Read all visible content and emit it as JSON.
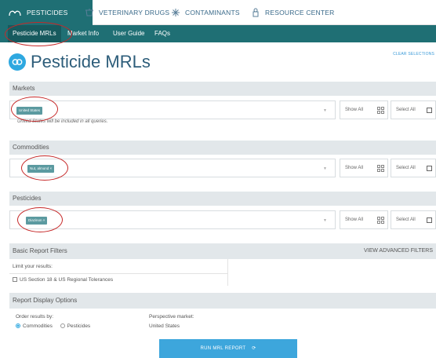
{
  "topnav": {
    "tabs": [
      {
        "label": "PESTICIDES",
        "icon": "pesticide-icon",
        "active": true
      },
      {
        "label": "VETERINARY DRUGS",
        "icon": "feeder-icon",
        "active": false
      },
      {
        "label": "CONTAMINANTS",
        "icon": "contaminant-icon",
        "active": false
      },
      {
        "label": "RESOURCE CENTER",
        "icon": "resource-icon",
        "active": false
      }
    ]
  },
  "subnav": {
    "items": [
      {
        "label": "Pesticide MRLs",
        "active": true
      },
      {
        "label": "Market Info",
        "active": false
      },
      {
        "label": "User Guide",
        "active": false
      },
      {
        "label": "FAQs",
        "active": false
      }
    ]
  },
  "page": {
    "title": "Pesticide MRLs",
    "clear_selections": "CLEAR SELECTIONS"
  },
  "markets": {
    "header": "Markets",
    "chip": "United States",
    "note": "United States will be included in all queries.",
    "show_all": "Show All",
    "select_all": "Select All"
  },
  "commodities": {
    "header": "Commodities",
    "chip": "Nut, almond ×",
    "show_all": "Show All",
    "select_all": "Select All"
  },
  "pesticides": {
    "header": "Pesticides",
    "chip": "Diazinon ×",
    "show_all": "Show All",
    "select_all": "Select All"
  },
  "basic_filters": {
    "header": "Basic Report Filters",
    "advanced": "VIEW ADVANCED FILTERS",
    "limit_label": "Limit your results:",
    "option": "US Section 18 & US Regional Tolerances"
  },
  "display_options": {
    "header": "Report Display Options",
    "order_label": "Order results by:",
    "order_commodities": "Commodities",
    "order_pesticides": "Pesticides",
    "perspective_label": "Perspective market:",
    "perspective_value": "United States"
  },
  "run_button": "RUN MRL REPORT",
  "colors": {
    "teal": "#1f6f74",
    "accent_blue": "#3da6dc",
    "chip": "#5b9aa0",
    "annotation_red": "#c62828"
  }
}
